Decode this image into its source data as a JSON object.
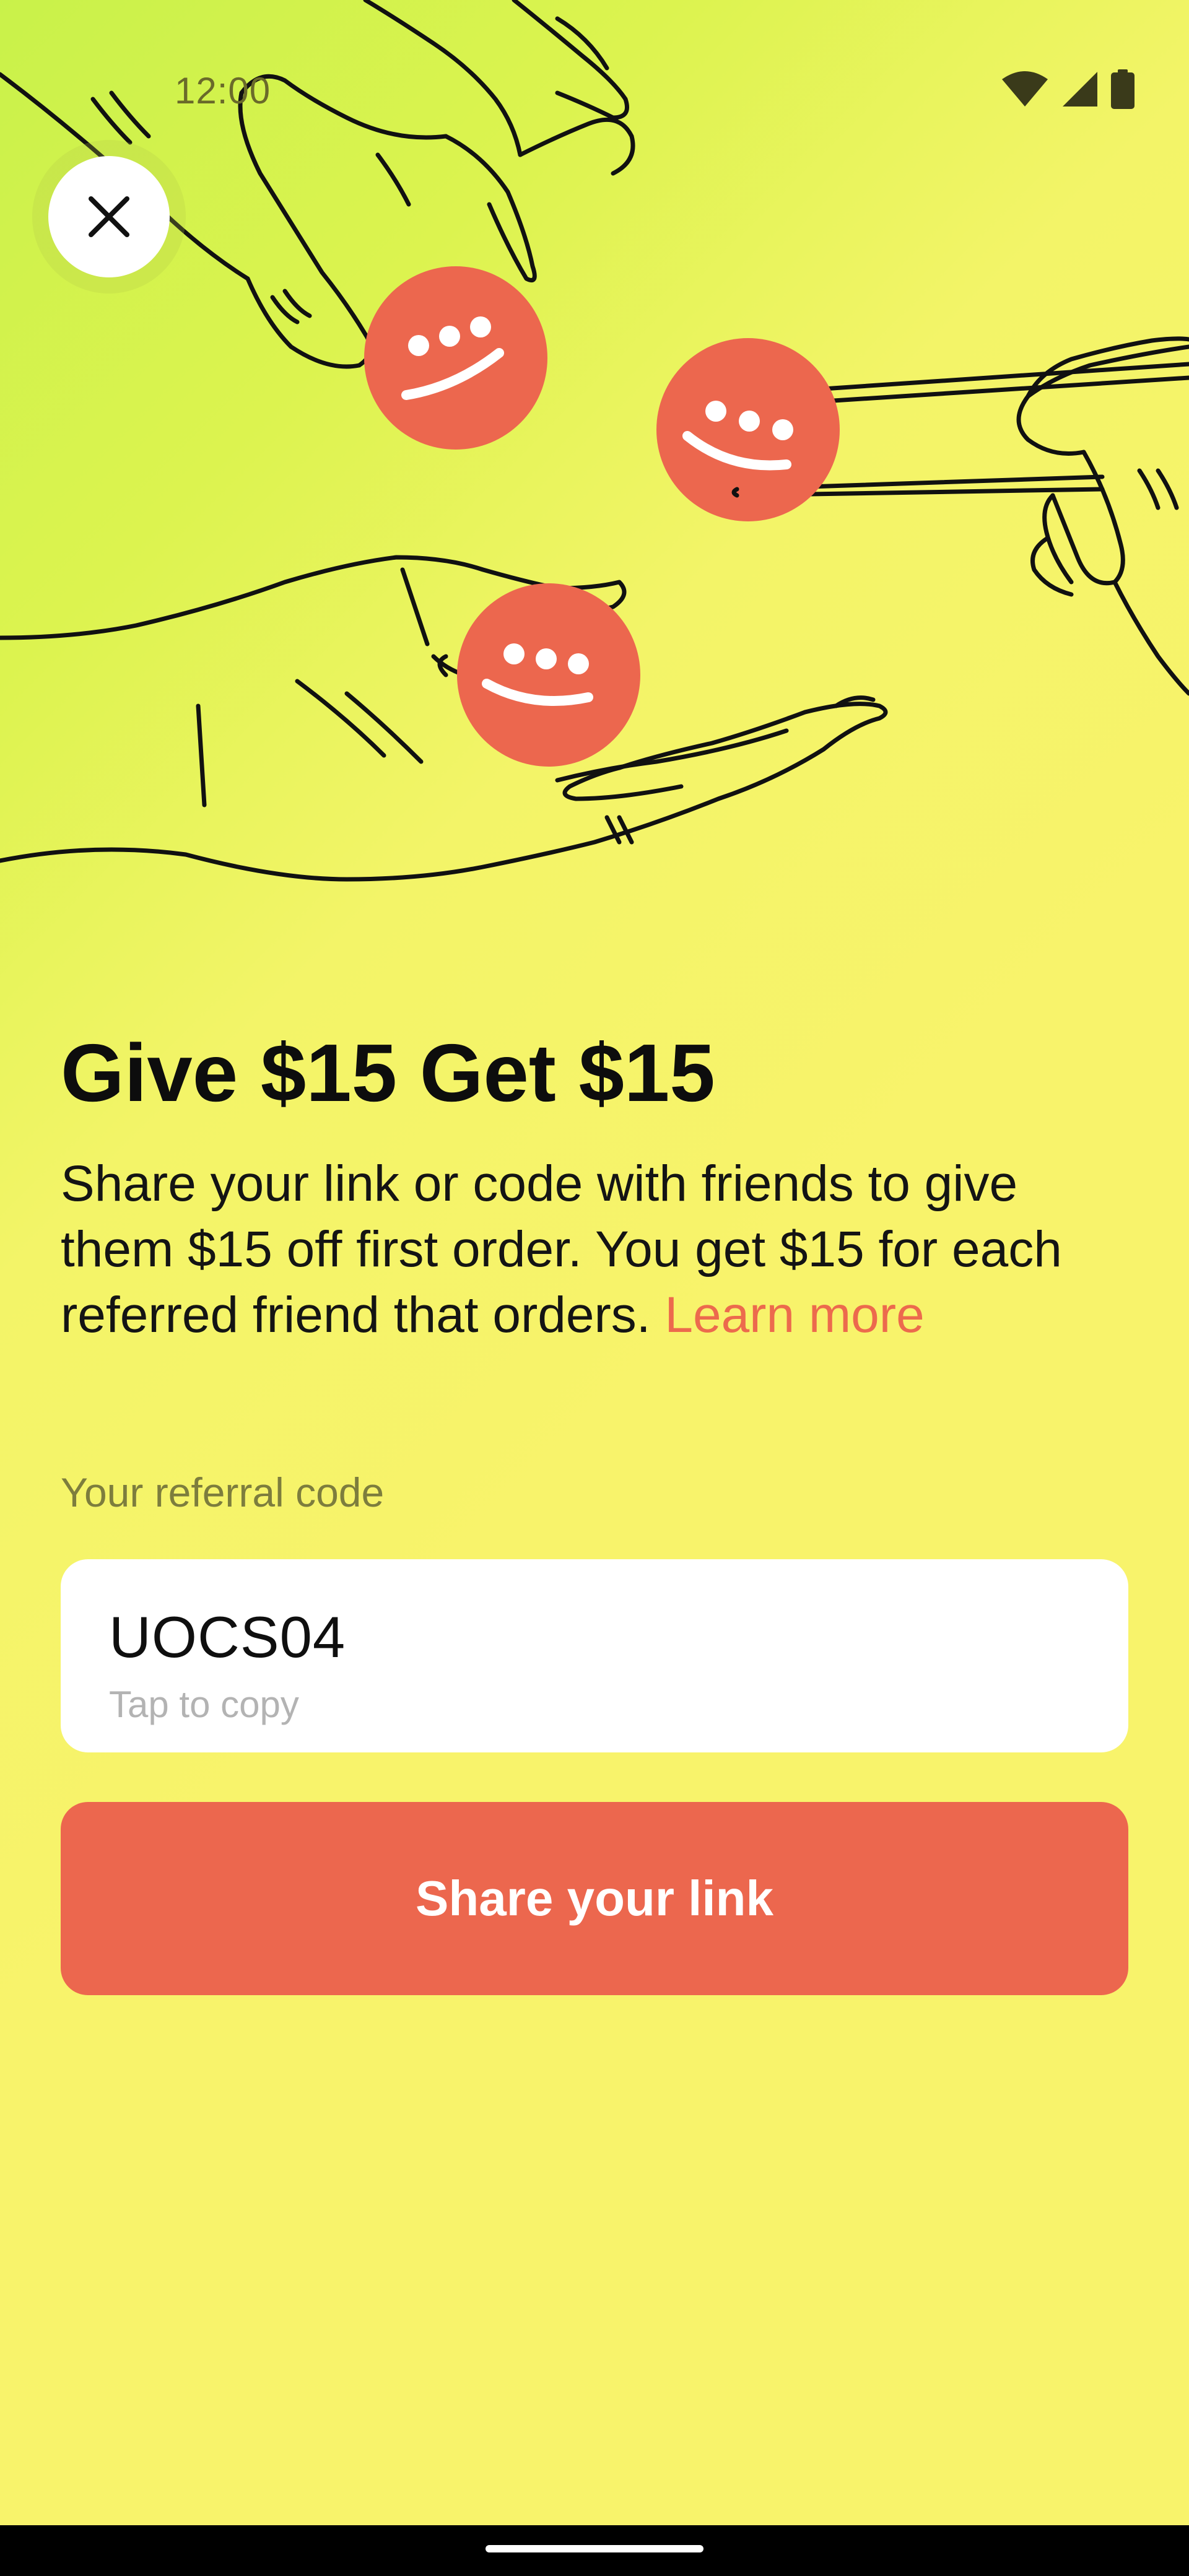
{
  "status_bar": {
    "time": "12:00",
    "icons": [
      "wifi-icon",
      "signal-icon",
      "battery-icon"
    ]
  },
  "hero": {
    "illustration": "hands-passing-coins",
    "coin_icon": "smiley-coin-icon"
  },
  "close_button": {
    "icon": "close-icon"
  },
  "content": {
    "headline": "Give $15 Get $15",
    "description": "Share your link or code with friends to give them $15 off first order. You get $15 for each referred friend that orders.",
    "learn_more": "Learn more"
  },
  "referral": {
    "label": "Your referral code",
    "code": "UOCS04",
    "hint": "Tap to copy"
  },
  "share_button": {
    "label": "Share your link"
  },
  "colors": {
    "accent": "#ec674e",
    "background": "#f8f36b",
    "background_top": "#c9f24a",
    "card": "#ffffff"
  }
}
